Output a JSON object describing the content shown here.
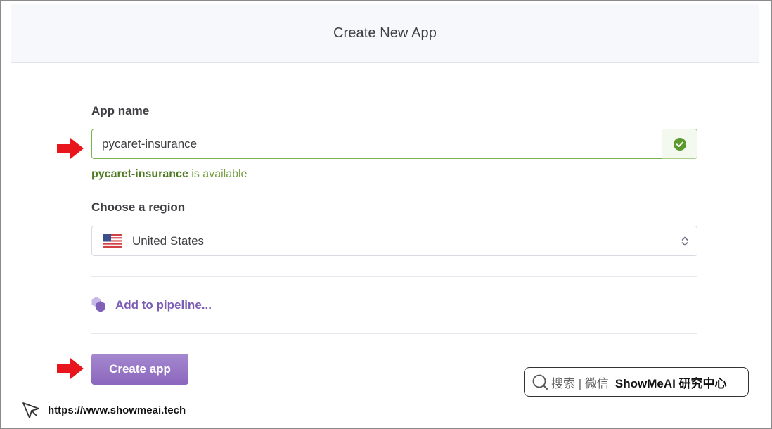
{
  "header": {
    "title": "Create New App"
  },
  "form": {
    "app_name_label": "App name",
    "app_name_value": "pycaret-insurance",
    "availability_name": "pycaret-insurance",
    "availability_suffix": " is available",
    "region_label": "Choose a region",
    "region_value": "United States",
    "region_flag_icon": "us-flag-icon",
    "pipeline_label": "Add to pipeline...",
    "pipeline_icon": "pipeline-hexagon-icon",
    "create_button_label": "Create app"
  },
  "watermark": {
    "search_text": "搜索 | 微信",
    "brand_text": "ShowMeAI 研究中心"
  },
  "footer": {
    "url": "https://www.showmeai.tech"
  },
  "colors": {
    "valid_green": "#79b14b",
    "available_text": "#74a142",
    "purple_accent": "#7b5eb3",
    "create_button": "#9677c6",
    "annotation_arrow": "#e8161c"
  }
}
